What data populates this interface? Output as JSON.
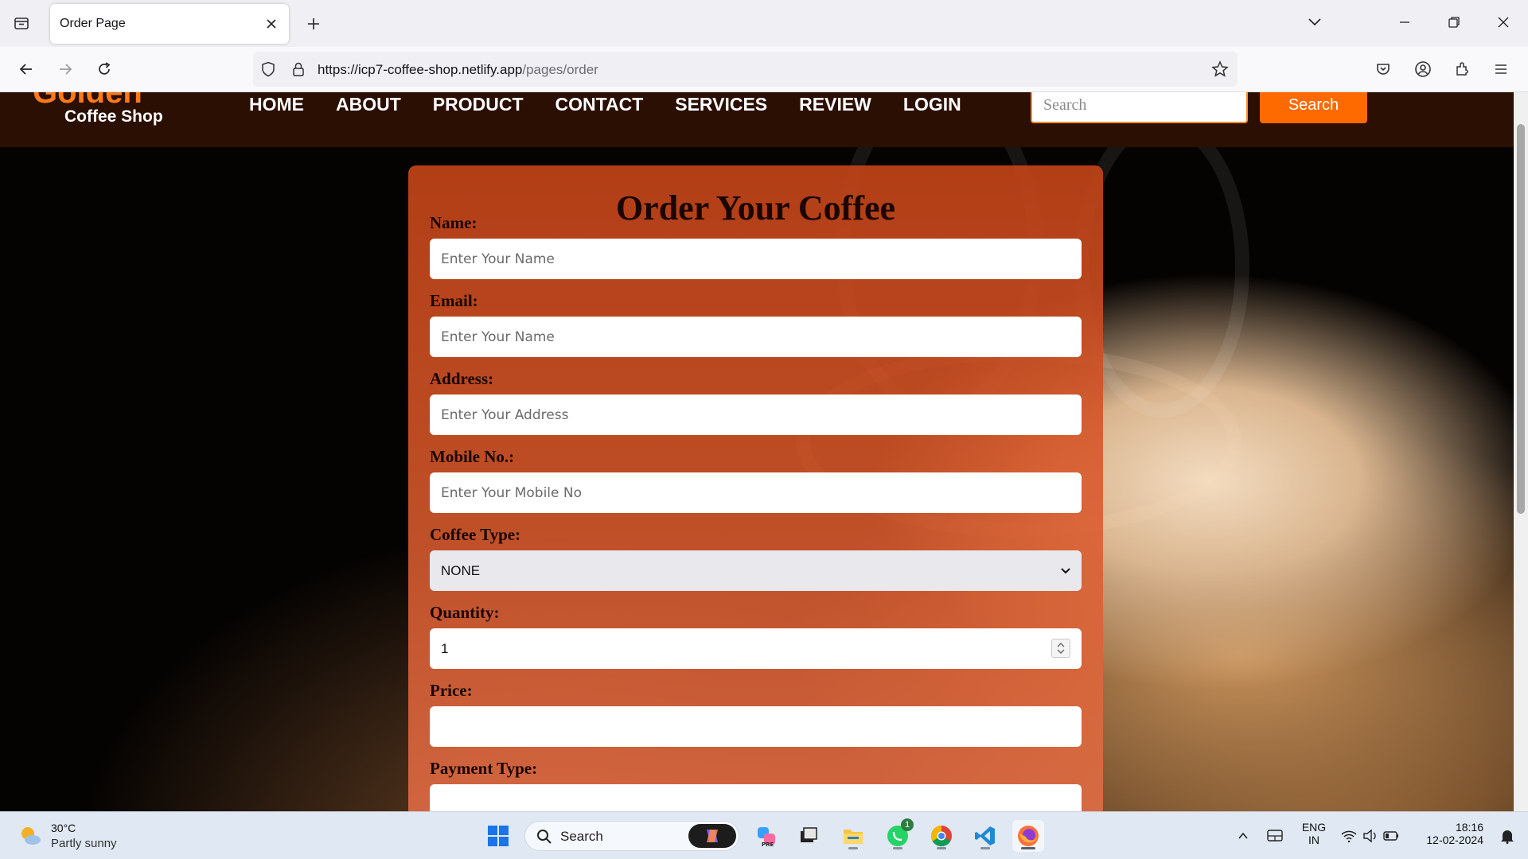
{
  "browser": {
    "tab_title": "Order Page",
    "url_host": "https://icp7-coffee-shop.netlify.app",
    "url_path": "/pages/order"
  },
  "site": {
    "logo_top": "Golden",
    "logo_sub": "Coffee Shop",
    "menu": [
      "HOME",
      "ABOUT",
      "PRODUCT",
      "CONTACT",
      "SERVICES",
      "REVIEW",
      "LOGIN"
    ],
    "search_placeholder": "Search",
    "search_button": "Search"
  },
  "form": {
    "title": "Order Your Coffee",
    "name_label": "Name:",
    "name_placeholder": "Enter Your Name",
    "email_label": "Email:",
    "email_placeholder": "Enter Your Name",
    "address_label": "Address:",
    "address_placeholder": "Enter Your Address",
    "mobile_label": "Mobile No.:",
    "mobile_placeholder": "Enter Your Mobile No",
    "coffee_type_label": "Coffee Type:",
    "coffee_type_value": "NONE",
    "quantity_label": "Quantity:",
    "quantity_value": "1",
    "price_label": "Price:",
    "price_value": "",
    "payment_label": "Payment Type:"
  },
  "taskbar": {
    "weather_temp": "30°C",
    "weather_desc": "Partly sunny",
    "search_label": "Search",
    "whatsapp_badge": "1",
    "lang_line1": "ENG",
    "lang_line2": "IN",
    "time": "18:16",
    "date": "12-02-2024"
  },
  "colors": {
    "header_bg": "#2b0f03",
    "accent_orange": "#ff6a00",
    "card_orange": "#c14318"
  }
}
